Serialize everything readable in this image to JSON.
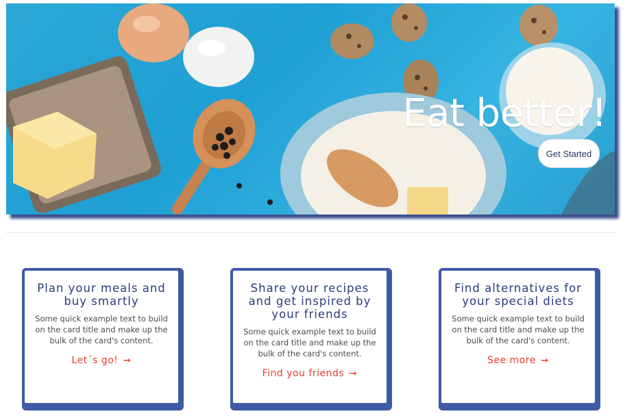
{
  "hero": {
    "title": "Eat better!",
    "button_label": "Get Started"
  },
  "cards": [
    {
      "title": "Plan your meals and buy smartly",
      "text": "Some quick example text to build on the card title and make up the bulk of the card's content.",
      "link": "Let´s go!",
      "arrow": "➞"
    },
    {
      "title": "Share your recipes and get inspired by your friends",
      "text": "Some quick example text to build on the card title and make up the bulk of the card's content.",
      "link": "Find you friends",
      "arrow": "➞"
    },
    {
      "title": "Find alternatives for your special diets",
      "text": "Some quick example text to build on the card title and make up the bulk of the card's content.",
      "link": "See more",
      "arrow": "➞"
    }
  ],
  "colors": {
    "accent": "#e8402c",
    "card_border": "#3f5aa6",
    "title_text": "#2a3b78",
    "hero_background": "#2aa7d6"
  }
}
